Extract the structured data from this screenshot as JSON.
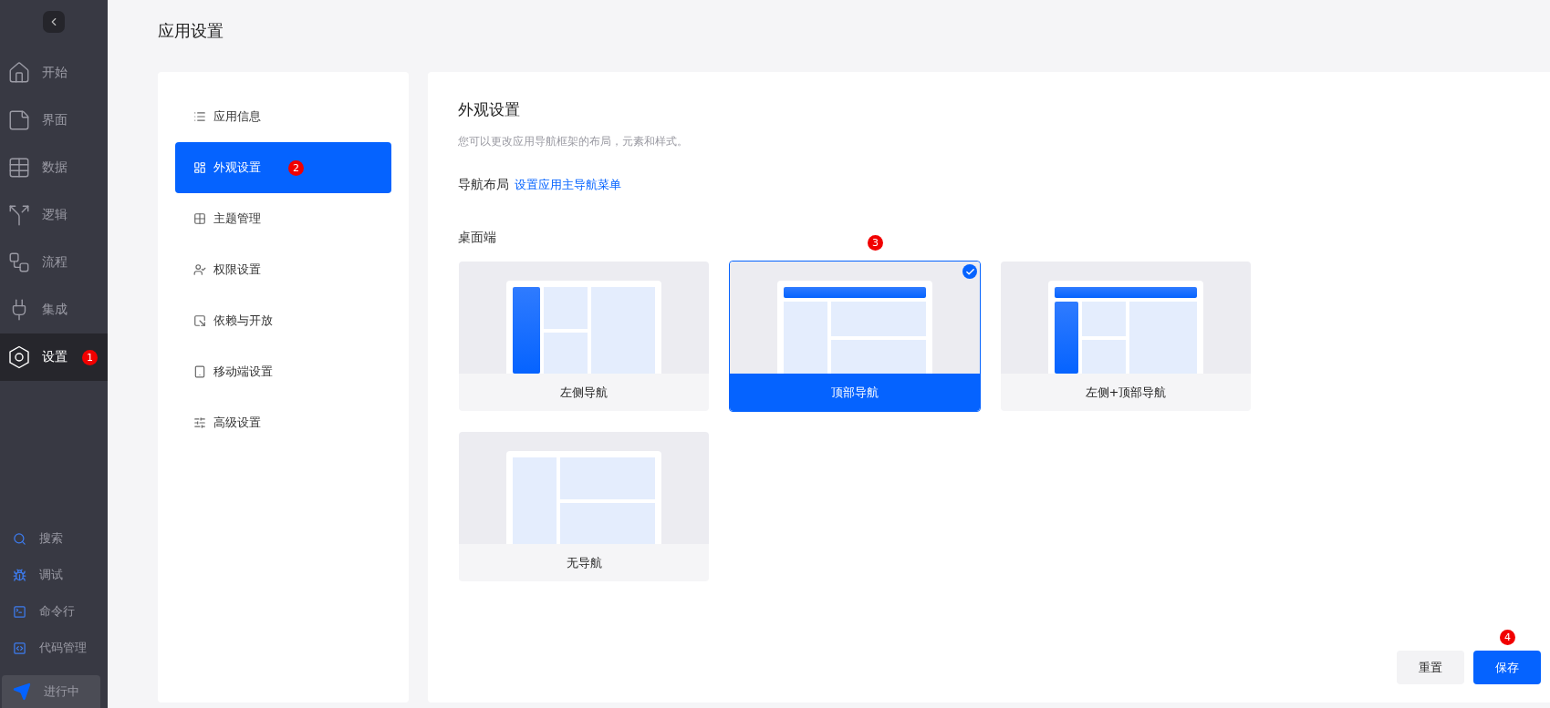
{
  "sidebar": {
    "nav_items": [
      {
        "label": "开始",
        "selected": false
      },
      {
        "label": "界面",
        "selected": false
      },
      {
        "label": "数据",
        "selected": false
      },
      {
        "label": "逻辑",
        "selected": false
      },
      {
        "label": "流程",
        "selected": false
      },
      {
        "label": "集成",
        "selected": false
      },
      {
        "label": "设置",
        "selected": true,
        "marker": "1"
      }
    ],
    "tools": [
      {
        "label": "搜索"
      },
      {
        "label": "调试"
      },
      {
        "label": "命令行"
      },
      {
        "label": "代码管理"
      }
    ],
    "status_button": {
      "label": "进行中"
    }
  },
  "page_title": "应用设置",
  "settings_menu": [
    {
      "label": "应用信息",
      "selected": false
    },
    {
      "label": "外观设置",
      "selected": true,
      "marker": "2"
    },
    {
      "label": "主题管理",
      "selected": false
    },
    {
      "label": "权限设置",
      "selected": false
    },
    {
      "label": "依赖与开放",
      "selected": false
    },
    {
      "label": "移动端设置",
      "selected": false
    },
    {
      "label": "高级设置",
      "selected": false
    }
  ],
  "panel": {
    "title": "外观设置",
    "description": "您可以更改应用导航框架的布局，元素和样式。",
    "nav_layout_label": "导航布局",
    "nav_layout_link": "设置应用主导航菜单",
    "section": "桌面端",
    "layouts": [
      {
        "kind": "left",
        "label": "左侧导航",
        "selected": false
      },
      {
        "kind": "top",
        "label": "顶部导航",
        "selected": true,
        "marker": "3"
      },
      {
        "kind": "lefttop",
        "label": "左侧+顶部导航",
        "selected": false
      },
      {
        "kind": "none",
        "label": "无导航",
        "selected": false
      }
    ],
    "buttons": [
      {
        "kind": "secondary",
        "label": "重置"
      },
      {
        "kind": "primary",
        "label": "保存",
        "marker": "4"
      }
    ]
  }
}
